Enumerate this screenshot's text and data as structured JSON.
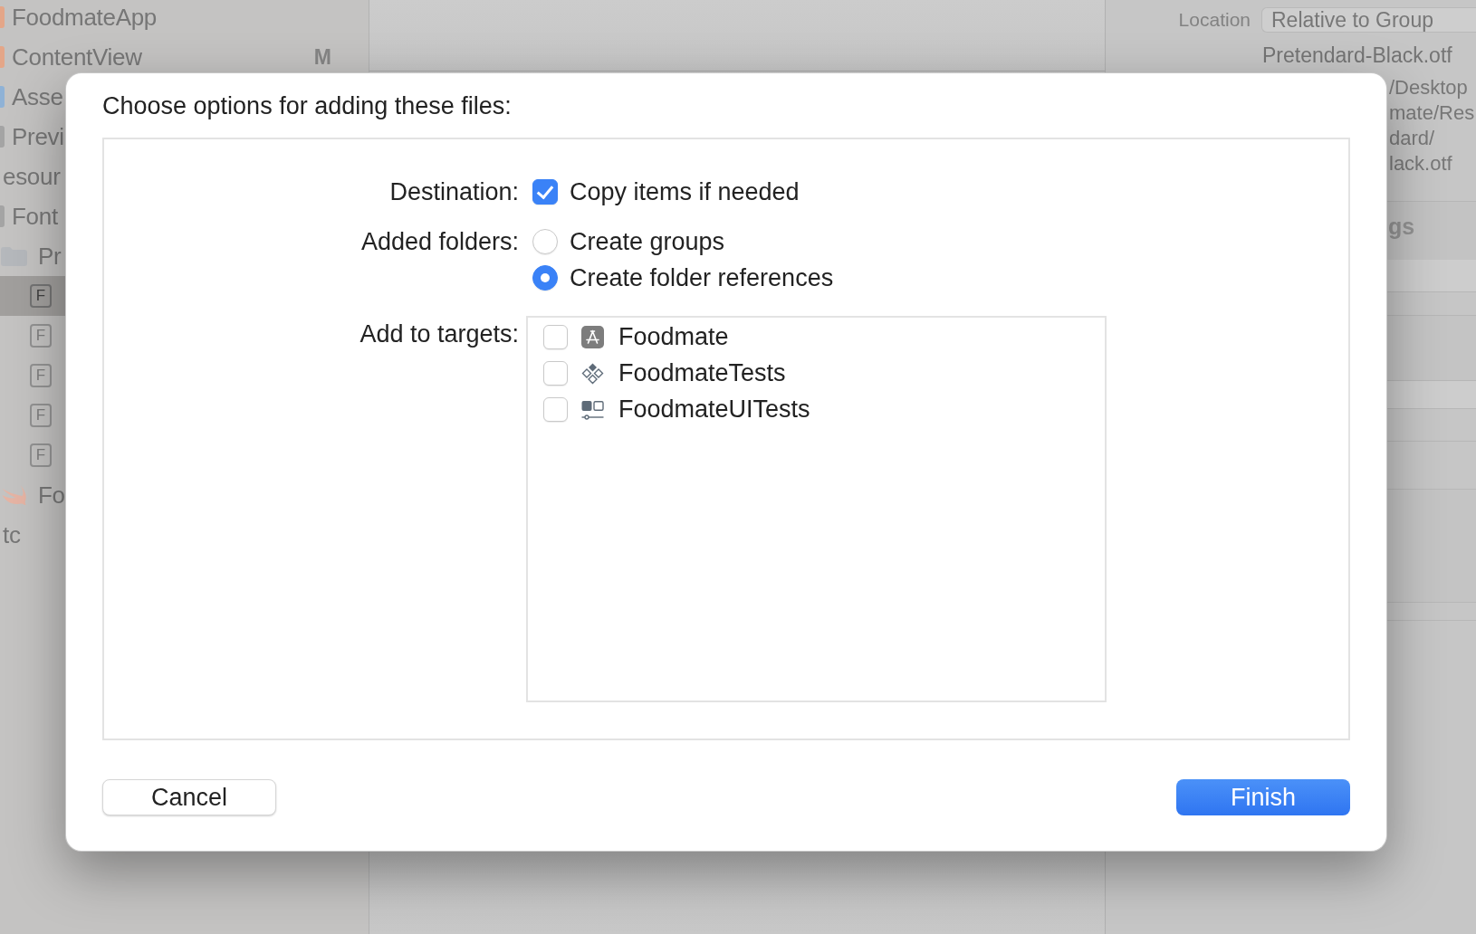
{
  "navigator": {
    "items": [
      {
        "children": [
          {
            "kind": "swift-file",
            "label": "FoodmateApp",
            "selected": false
          },
          {
            "kind": "swift-file",
            "label": "ContentView",
            "badge": "M",
            "selected": false
          },
          {
            "kind": "asset-catalog",
            "label": "Asse",
            "selected": false
          },
          {
            "kind": "group",
            "label": "Previ",
            "selected": false
          }
        ]
      },
      {
        "kind": "plain",
        "label": "esour",
        "selected": false,
        "children": [
          {
            "kind": "group",
            "label": "Font",
            "selected": false,
            "children": [
              {
                "kind": "folder",
                "label": "Pr",
                "selected": false,
                "children": [
                  {
                    "kind": "font-file",
                    "glyph": "F",
                    "selected": true
                  },
                  {
                    "kind": "font-file",
                    "glyph": "F",
                    "selected": false
                  },
                  {
                    "kind": "font-file",
                    "glyph": "F",
                    "selected": false
                  },
                  {
                    "kind": "font-file",
                    "glyph": "F",
                    "selected": false
                  },
                  {
                    "kind": "font-file",
                    "glyph": "F",
                    "selected": false
                  }
                ]
              },
              {
                "kind": "swift",
                "label": "Fo",
                "selected": false
              }
            ]
          }
        ]
      },
      {
        "kind": "plain",
        "label": "tc",
        "selected": false
      }
    ]
  },
  "dialog": {
    "title": "Choose options for adding these files:",
    "form": [
      {
        "kind": "checkboxes",
        "label": "Destination:",
        "options": [
          {
            "label": "Copy items if needed",
            "checked": true
          }
        ]
      },
      {
        "kind": "radios",
        "label": "Added folders:",
        "options": [
          {
            "label": "Create groups",
            "selected": false
          },
          {
            "label": "Create folder references",
            "selected": true
          }
        ]
      },
      {
        "kind": "targets",
        "label": "Add to targets:",
        "items": [
          {
            "kind": "app",
            "label": "Foodmate",
            "checked": false
          },
          {
            "kind": "unit-tests",
            "label": "FoodmateTests",
            "checked": false
          },
          {
            "kind": "ui-tests",
            "label": "FoodmateUITests",
            "checked": false
          }
        ]
      }
    ],
    "buttons": [
      {
        "kind": "cancel",
        "label": "Cancel"
      },
      {
        "kind": "default",
        "label": "Finish"
      }
    ]
  },
  "inspector": {
    "location": {
      "label": "Location",
      "value": "Relative to Group"
    },
    "file_name": "Pretendard-Black.otf",
    "full_path": [
      "/Desktop",
      "mate/Res",
      "dard/",
      "lack.otf"
    ],
    "section_title": "gs"
  }
}
